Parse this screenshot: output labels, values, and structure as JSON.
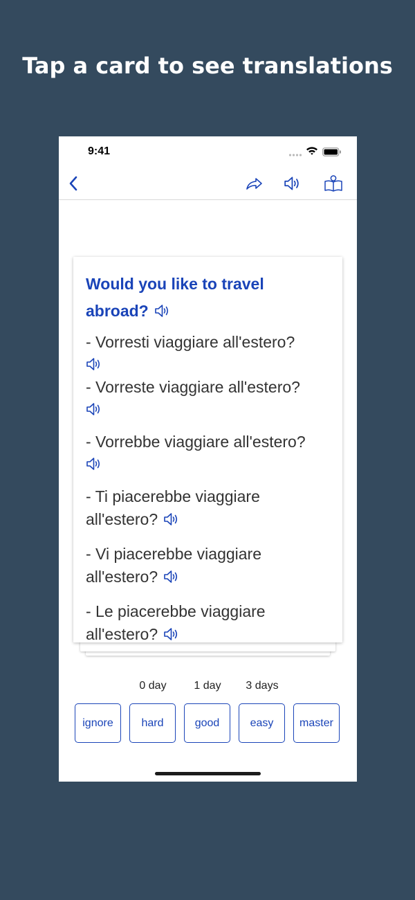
{
  "promo": {
    "title": "Tap a card to see translations"
  },
  "status_bar": {
    "time": "9:41"
  },
  "nav": {
    "back_icon": "chevron-left-icon",
    "share_icon": "share-arrow-icon",
    "speaker_icon": "speaker-icon",
    "book_icon": "book-reader-icon"
  },
  "card": {
    "question": "Would you like to travel abroad?",
    "answers": [
      "- Vorresti viaggiare all'estero?",
      "- Vorreste viaggiare all'estero?",
      "- Vorrebbe viaggiare all'estero?",
      "- Ti piacerebbe viaggiare all'estero?",
      "- Vi piacerebbe viaggiare all'estero?",
      "- Le piacerebbe viaggiare all'estero?"
    ]
  },
  "review": {
    "intervals": {
      "hard": "0 day",
      "good": "1 day",
      "easy": "3 days"
    },
    "buttons": {
      "ignore": "ignore",
      "hard": "hard",
      "good": "good",
      "easy": "easy",
      "master": "master"
    }
  },
  "colors": {
    "background": "#344a5e",
    "accent": "#1a44b8",
    "text": "#333333"
  }
}
